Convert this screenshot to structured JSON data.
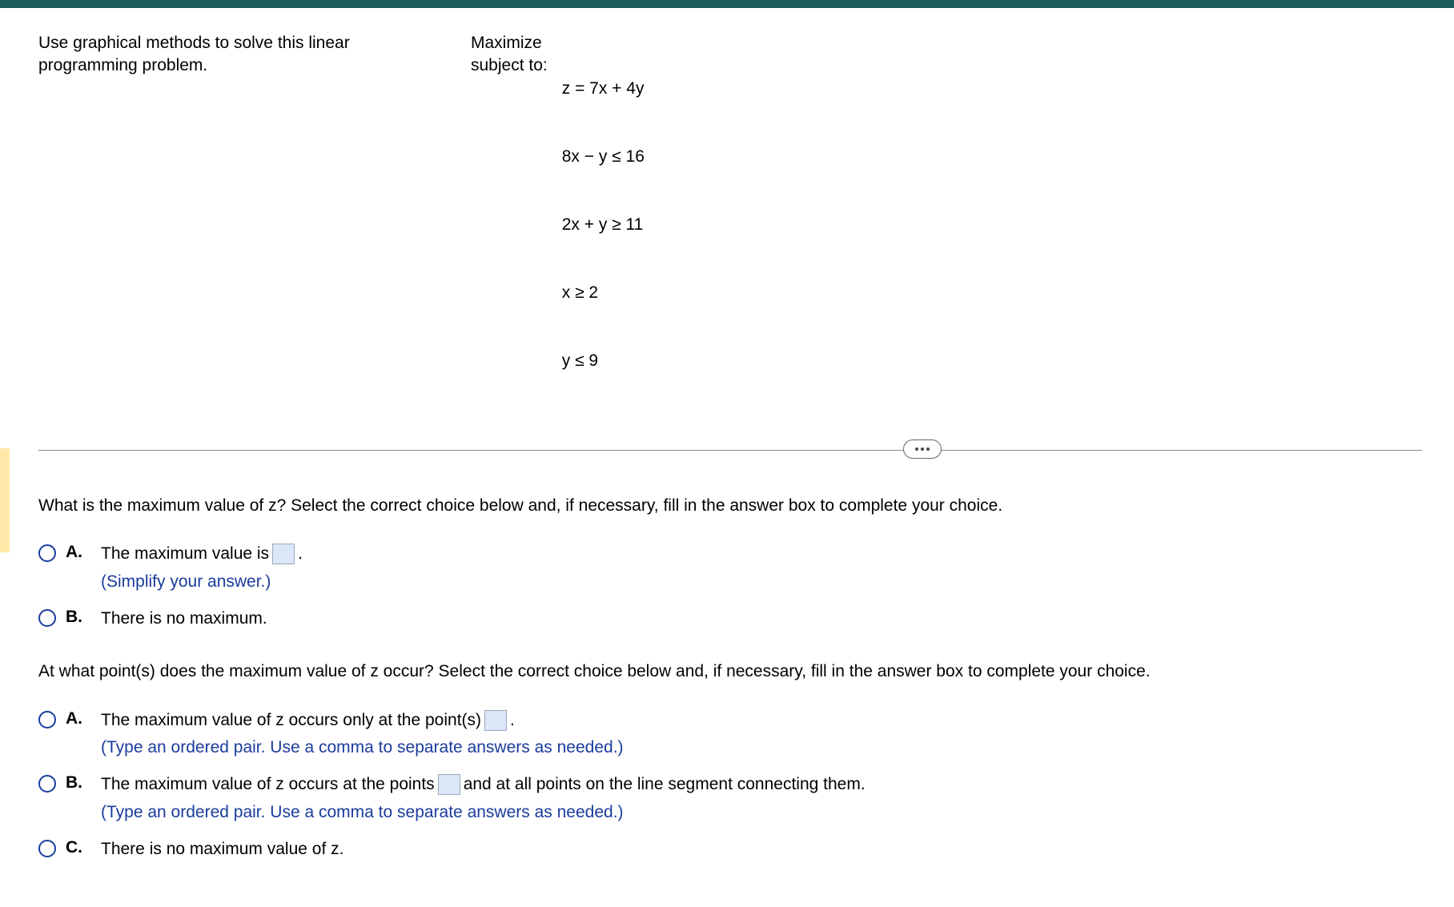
{
  "problem": {
    "intro": "Use graphical methods to solve this linear programming problem.",
    "objective_label": "Maximize",
    "constraint_label": "subject to:",
    "objective": "z = 7x + 4y",
    "constraints": [
      "8x − y ≤ 16",
      "2x + y ≥ 11",
      "x ≥ 2",
      "y ≤ 9"
    ]
  },
  "question1": {
    "prompt": "What is the maximum value of z? Select the correct choice below and, if necessary, fill in the answer box to complete your choice.",
    "choices": {
      "A": {
        "label": "A.",
        "text_before": "The maximum value is ",
        "text_after": ".",
        "hint": "(Simplify your answer.)"
      },
      "B": {
        "label": "B.",
        "text": "There is no maximum."
      }
    }
  },
  "question2": {
    "prompt": "At what point(s) does the maximum value of z occur? Select the correct choice below and, if necessary, fill in the answer box to complete your choice.",
    "choices": {
      "A": {
        "label": "A.",
        "text_before": "The maximum value of z occurs only at the point(s) ",
        "text_after": ".",
        "hint": "(Type an ordered pair. Use a comma to separate answers as needed.)"
      },
      "B": {
        "label": "B.",
        "text_before": "The maximum value of z occurs at the points ",
        "text_after": " and at all points on the line segment connecting them.",
        "hint": "(Type an ordered pair. Use a comma to separate answers as needed.)"
      },
      "C": {
        "label": "C.",
        "text": "There is no maximum value of z."
      }
    }
  }
}
